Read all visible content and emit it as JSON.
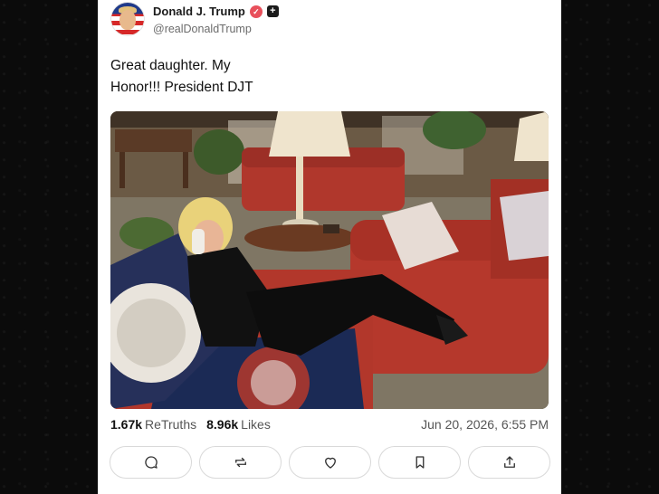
{
  "post": {
    "author": {
      "display_name": "Donald J. Trump",
      "handle": "@realDonaldTrump",
      "verified_icon": "check-icon",
      "badge_icon": "plus-icon"
    },
    "text_line_1": "Great daughter. My",
    "text_line_2": "Honor!!! President DJT",
    "photo": {
      "subject": "photo-of-woman-on-red-couch-with-phone"
    },
    "stats": {
      "retruths_count": "1.67k",
      "retruths_label": "ReTruths",
      "likes_count": "8.96k",
      "likes_label": "Likes"
    },
    "timestamp": "Jun 20, 2026, 6:55 PM",
    "actions": [
      {
        "name": "reply",
        "icon": "comment-icon"
      },
      {
        "name": "retruth",
        "icon": "repost-icon"
      },
      {
        "name": "like",
        "icon": "heart-icon"
      },
      {
        "name": "bookmark",
        "icon": "bookmark-icon"
      },
      {
        "name": "share",
        "icon": "share-icon"
      }
    ]
  },
  "colors": {
    "background": "#0b0b0b",
    "card": "#ffffff",
    "verified_badge": "#e8505b",
    "couch_red": "#b5382c"
  }
}
